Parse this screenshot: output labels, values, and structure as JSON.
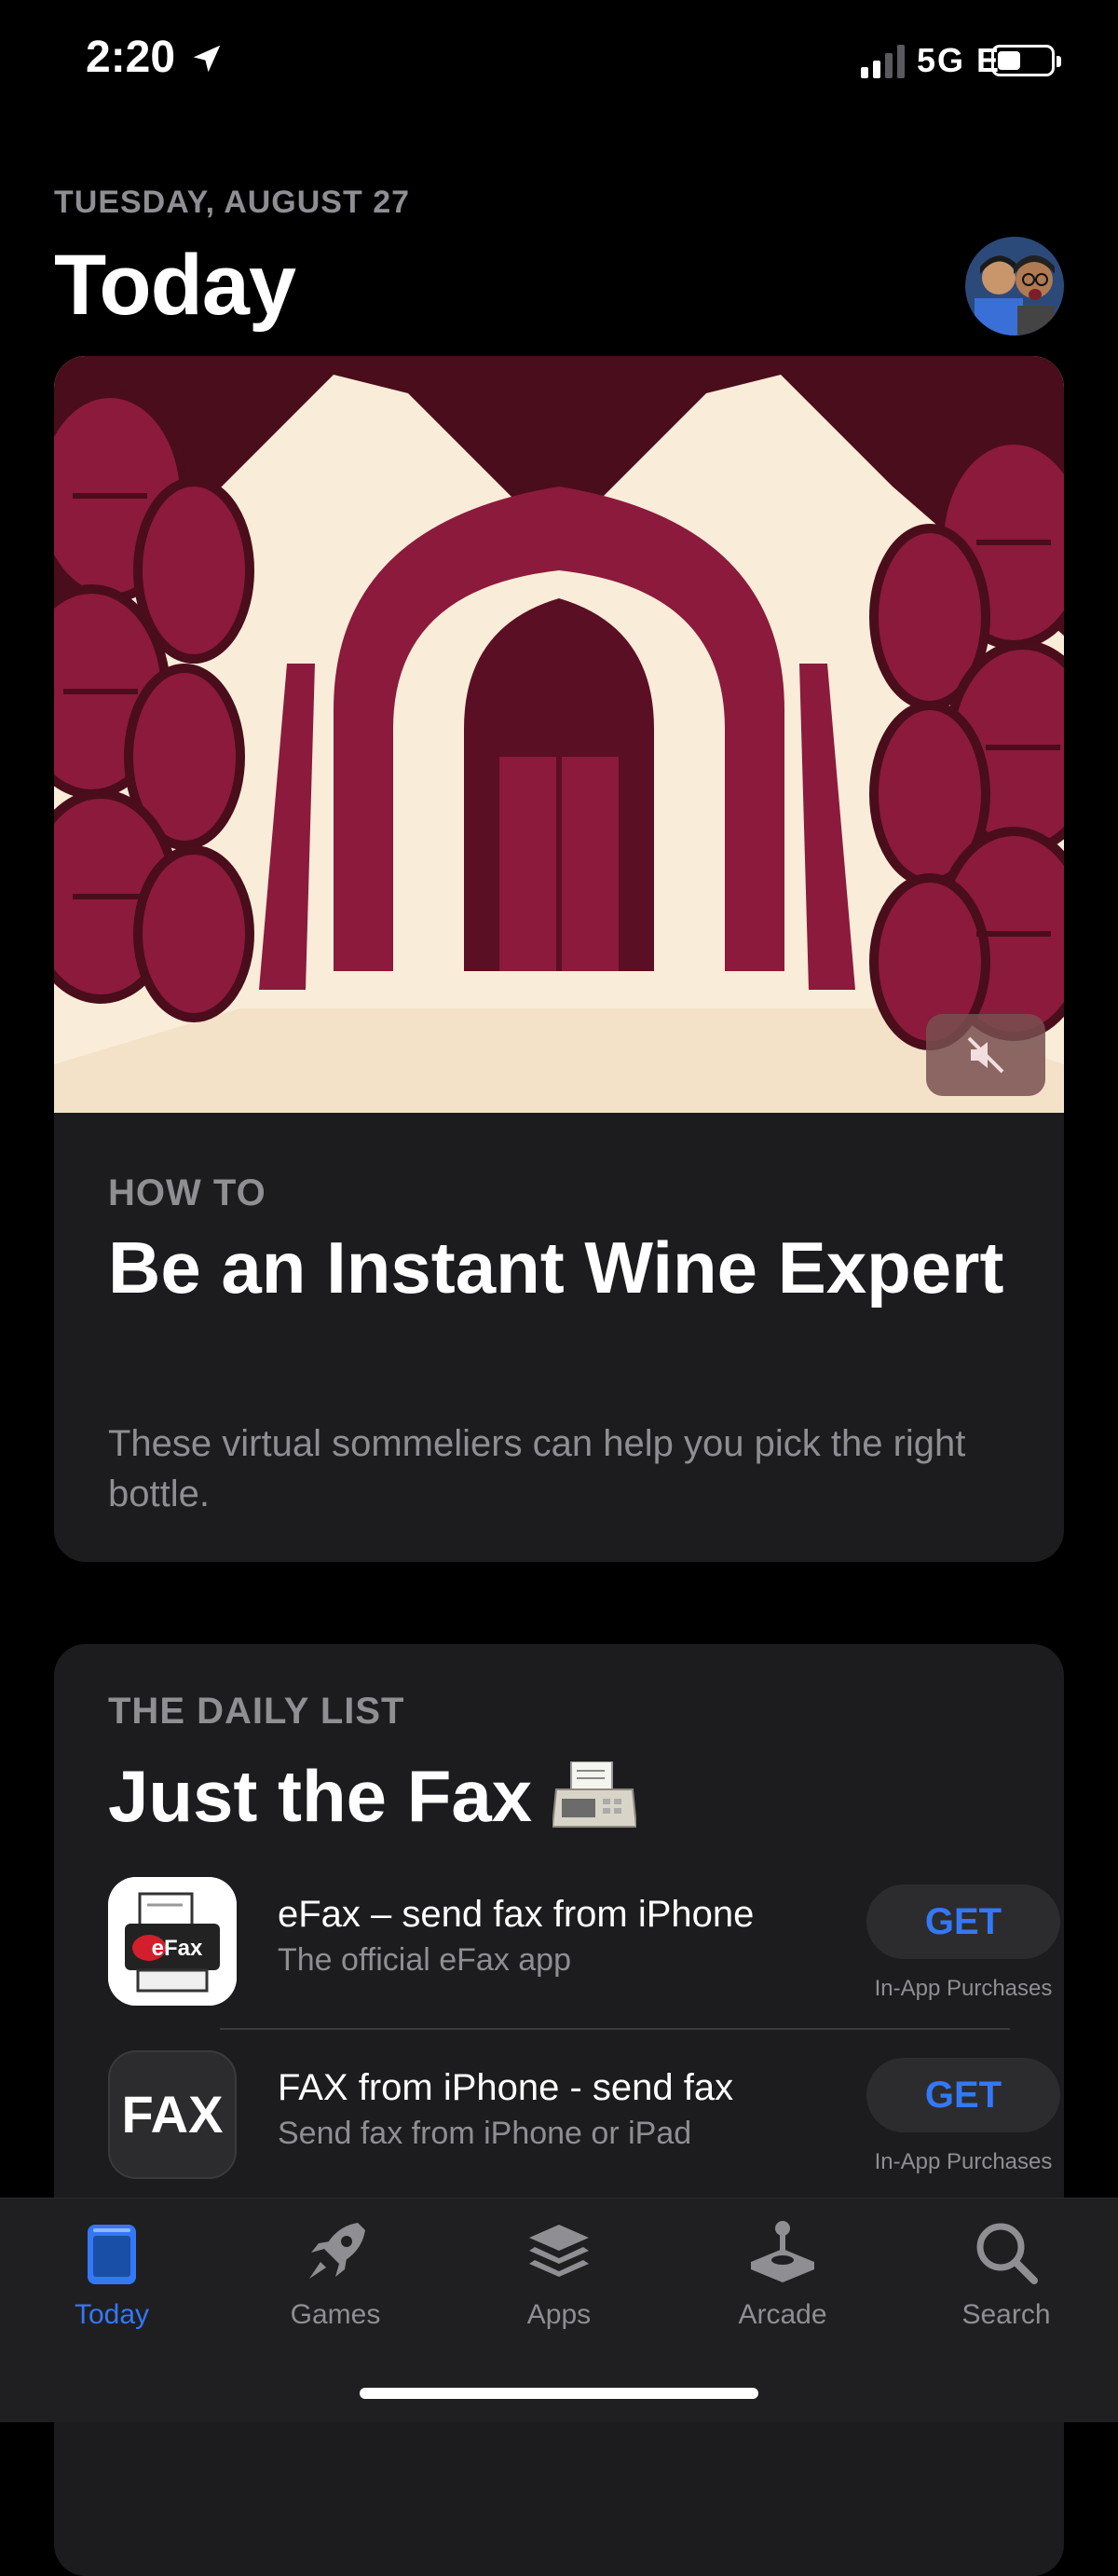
{
  "status_bar": {
    "time": "2:20",
    "network": "5G E"
  },
  "header": {
    "date": "TUESDAY, AUGUST 27",
    "title": "Today"
  },
  "featured_card": {
    "eyebrow": "HOW TO",
    "title": "Be an Instant Wine Expert",
    "description": "These virtual sommeliers can help you pick the right bottle.",
    "mute_icon": "speaker-muted-icon"
  },
  "daily_list": {
    "eyebrow": "THE DAILY LIST",
    "title": "Just the Fax",
    "apps": [
      {
        "name": "eFax – send fax from iPhone",
        "subtitle": "The official eFax app",
        "button": "GET",
        "note": "In-App Purchases",
        "icon_text": "eFax"
      },
      {
        "name": "FAX from iPhone - send fax",
        "subtitle": "Send fax from iPhone or iPad",
        "button": "GET",
        "note": "In-App Purchases",
        "icon_text": "FAX"
      }
    ]
  },
  "tab_bar": {
    "active": "Today",
    "tabs": [
      {
        "label": "Today",
        "icon": "today-icon"
      },
      {
        "label": "Games",
        "icon": "rocket-icon"
      },
      {
        "label": "Apps",
        "icon": "layers-icon"
      },
      {
        "label": "Arcade",
        "icon": "joystick-icon"
      },
      {
        "label": "Search",
        "icon": "search-icon"
      }
    ]
  },
  "colors": {
    "accent": "#3478f6",
    "background": "#000000",
    "card": "#1c1c1e",
    "wine": "#8b1a3c",
    "cream": "#f9ecd8"
  }
}
